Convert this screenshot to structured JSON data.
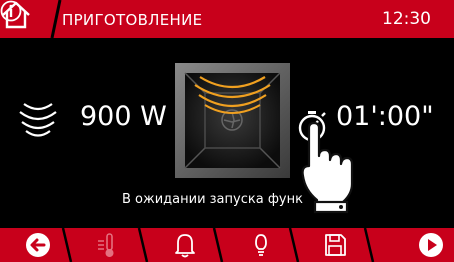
{
  "header": {
    "title": "ПРИГОТОВЛЕНИЕ",
    "clock": "12:30"
  },
  "cooking": {
    "power": "900 W",
    "time": "01':00\""
  },
  "status_text": "В ожидании запуска функ",
  "colors": {
    "accent": "#c8001b",
    "background": "#000000",
    "heat": "#f0a020"
  },
  "toolbar": {
    "icons": [
      "back-arrow-icon",
      "thermometer-icon",
      "bell-icon",
      "lightbulb-icon",
      "save-icon",
      "play-icon"
    ]
  }
}
